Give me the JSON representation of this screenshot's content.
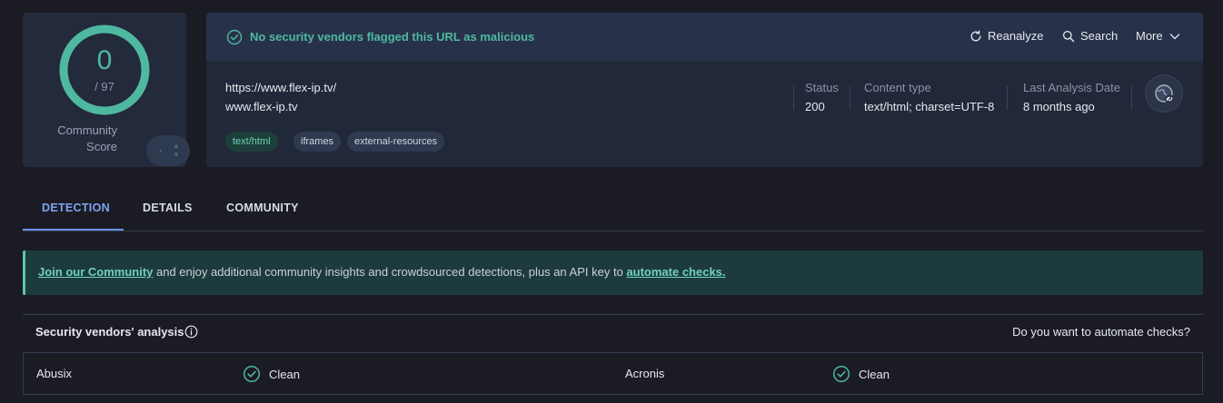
{
  "score": {
    "detections": "0",
    "total": "/ 97",
    "community_label_line1": "Community",
    "community_label_line2": "Score"
  },
  "banner": {
    "message": "No security vendors flagged this URL as malicious",
    "actions": {
      "reanalyze": "Reanalyze",
      "search": "Search",
      "more": "More"
    }
  },
  "url": {
    "full": "https://www.flex-ip.tv/",
    "host": "www.flex-ip.tv",
    "tags": [
      "text/html",
      "iframes",
      "external-resources"
    ]
  },
  "meta": {
    "status_label": "Status",
    "status_value": "200",
    "content_type_label": "Content type",
    "content_type_value": "text/html; charset=UTF-8",
    "last_analysis_label": "Last Analysis Date",
    "last_analysis_value": "8 months ago"
  },
  "tabs": [
    "DETECTION",
    "DETAILS",
    "COMMUNITY"
  ],
  "notice": {
    "link1": "Join our Community",
    "text": " and enjoy additional community insights and crowdsourced detections, plus an API key to ",
    "link2": "automate checks."
  },
  "vendors": {
    "title": "Security vendors' analysis",
    "automate": "Do you want to automate checks?",
    "rows": [
      {
        "name": "Abusix",
        "result": "Clean"
      },
      {
        "name": "Acronis",
        "result": "Clean"
      }
    ]
  },
  "colors": {
    "accent_green": "#4fb8a0",
    "active_tab": "#7fa4f2",
    "background": "#1b1b24"
  },
  "icons": {
    "banner": "check-circle-icon",
    "reanalyze": "refresh-icon",
    "search": "search-icon",
    "more": "chevron-down-icon",
    "globe": "globe-link-icon",
    "info": "info-icon",
    "clean": "check-circle-icon"
  }
}
